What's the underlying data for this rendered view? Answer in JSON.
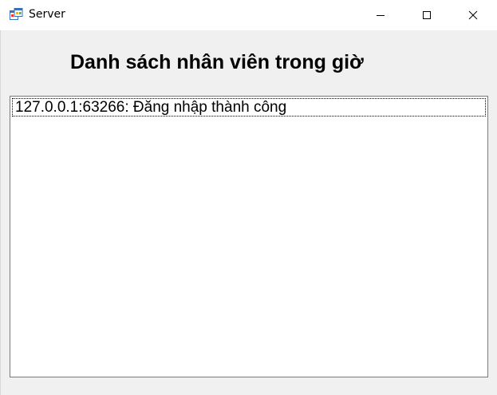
{
  "window": {
    "title": "Server",
    "icon": "windows-form-icon"
  },
  "titlebar_buttons": {
    "minimize": "minimize-icon",
    "maximize": "maximize-icon",
    "close": "close-icon"
  },
  "main": {
    "heading": "Danh sách nhân viên trong giờ",
    "list_items": [
      "127.0.0.1:63266: Đăng nhập thành công"
    ]
  },
  "colors": {
    "titlebar": "#ffffff",
    "client_area": "#f0f0f0",
    "listbox_border": "#7a7a7a"
  }
}
